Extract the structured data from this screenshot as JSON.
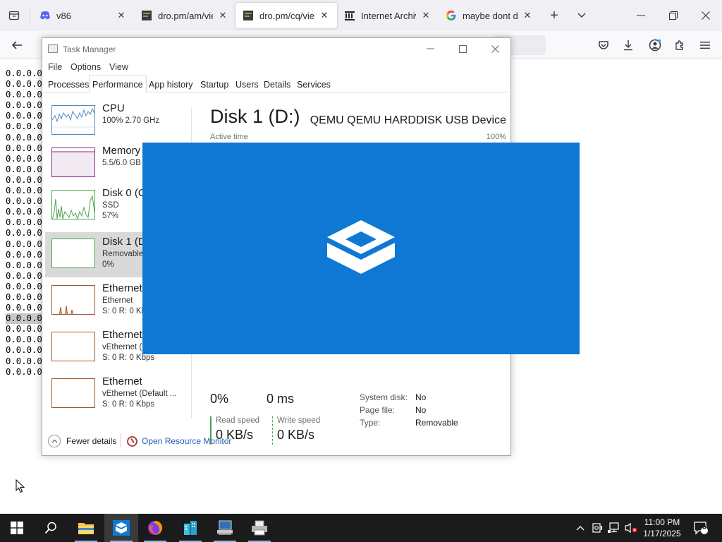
{
  "browser": {
    "tabs": [
      {
        "title": "v86",
        "favicon": "discord-bot-icon",
        "active": false
      },
      {
        "title": "dro.pm/am/view",
        "favicon": "terminal-icon",
        "active": false
      },
      {
        "title": "dro.pm/cq/view",
        "favicon": "terminal-icon",
        "active": true
      },
      {
        "title": "Internet Archive",
        "favicon": "archive-icon",
        "active": false
      },
      {
        "title": "maybe dont do t",
        "favicon": "google-icon",
        "active": false
      }
    ],
    "new_tab_glyph": "+",
    "tab_close_glyph": "✕",
    "list_all_tabs_glyph": "⌵",
    "window_controls": {
      "minimize": "—",
      "maximize": "❐",
      "close": "✕"
    },
    "nav": {
      "back_glyph": "←",
      "pocket_glyph": "⛉",
      "download_glyph": "⤓",
      "account_glyph": "◉",
      "extensions_glyph": "⧉",
      "menu_glyph": "☰"
    }
  },
  "page": {
    "lines": [
      "0.0.0.0",
      "0.0.0.0",
      "0.0.0.0",
      "0.0.0.0",
      "0.0.0.0",
      "0.0.0.0",
      "0.0.0.0",
      "0.0.0.0",
      "0.0.0.0",
      "0.0.0.0",
      "0.0.0.0",
      "0.0.0.0",
      "0.0.0.0",
      "0.0.0.0",
      "0.0.0.0",
      "0.0.0.0",
      "0.0.0.0",
      "0.0.0.0",
      "0.0.0.0",
      "0.0.0.0",
      "0.0.0.0",
      "0.0.0.0",
      "0.0.0.0",
      "0.0.0.0",
      "0.0.0.0",
      "0.0.0.0",
      "0.0.0.0",
      "0.0.0.0",
      "0.0.0.0"
    ],
    "selected_line_index": 23
  },
  "taskmgr": {
    "title": "Task Manager",
    "controls": {
      "minimize": "—",
      "maximize": "☐",
      "close": "✕"
    },
    "menu": [
      "File",
      "Options",
      "View"
    ],
    "tabs": [
      "Processes",
      "Performance",
      "App history",
      "Startup",
      "Users",
      "Details",
      "Services"
    ],
    "active_tab": "Performance",
    "sidebar": [
      {
        "name": "CPU",
        "sub1": "100%  2.70 GHz",
        "sub2": "",
        "color": "#4a8cc2"
      },
      {
        "name": "Memory",
        "sub1": "5.5/6.0 GB",
        "sub2": "",
        "color": "#8b2c8b"
      },
      {
        "name": "Disk 0 (C",
        "sub1": "SSD",
        "sub2": "57%",
        "color": "#4da34d"
      },
      {
        "name": "Disk 1 (D",
        "sub1": "Removable",
        "sub2": "0%",
        "color": "#4da34d"
      },
      {
        "name": "Ethernet",
        "sub1": "Ethernet",
        "sub2": "S: 0  R: 0 Kb",
        "color": "#a05a2c"
      },
      {
        "name": "Ethernet",
        "sub1": "vEthernet (",
        "sub2": "S: 0  R: 0 Kbps",
        "color": "#a05a2c"
      },
      {
        "name": "Ethernet",
        "sub1": "vEthernet (Default ...",
        "sub2": "S: 0  R: 0 Kbps",
        "color": "#a05a2c"
      }
    ],
    "selected_index": 3,
    "detail": {
      "title": "Disk 1 (D:)",
      "model": "QEMU QEMU HARDDISK USB Device",
      "active_time_label": "Active time",
      "active_time_max": "100%",
      "active_time_value": "0%",
      "response_time_value": "0 ms",
      "read_speed_label": "Read speed",
      "read_speed_value": "0 KB/s",
      "write_speed_label": "Write speed",
      "write_speed_value": "0 KB/s",
      "properties": [
        {
          "key": "System disk:",
          "value": "No"
        },
        {
          "key": "Page file:",
          "value": "No"
        },
        {
          "key": "Type:",
          "value": "Removable"
        }
      ]
    },
    "footer": {
      "fewer_details": "Fewer details",
      "resource_monitor": "Open Resource Monitor"
    }
  },
  "splash": {
    "background": "#0f78d4",
    "icon": "windows-sandbox-icon"
  },
  "taskbar": {
    "apps": [
      {
        "name": "start",
        "icon": "windows-logo-icon"
      },
      {
        "name": "search",
        "icon": "search-icon"
      },
      {
        "name": "file-explorer",
        "icon": "folder-icon"
      },
      {
        "name": "windows-sandbox",
        "icon": "sandbox-icon"
      },
      {
        "name": "firefox",
        "icon": "firefox-icon"
      },
      {
        "name": "app-buildings",
        "icon": "buildings-icon"
      },
      {
        "name": "app-computer",
        "icon": "computer-icon"
      },
      {
        "name": "app-printer",
        "icon": "printer-icon"
      }
    ],
    "clock_time": "11:00 PM",
    "clock_date": "1/17/2025",
    "notification_count": "6"
  }
}
